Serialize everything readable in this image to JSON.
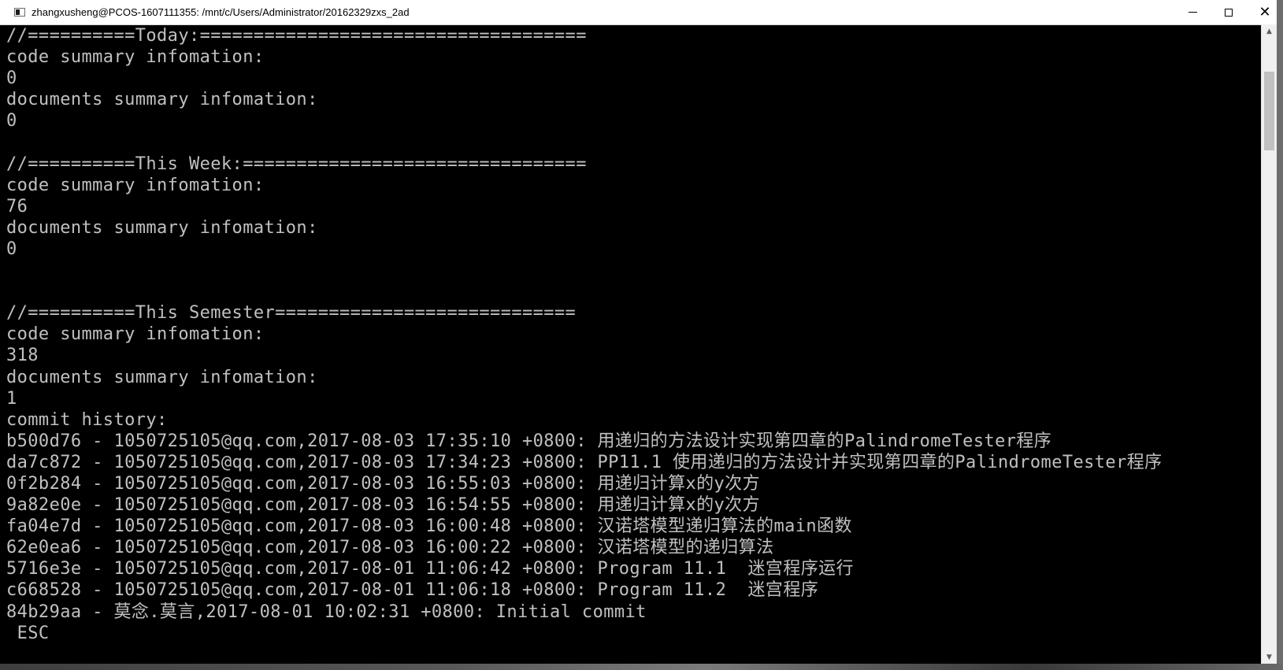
{
  "window": {
    "title": "zhangxusheng@PCOS-1607111355: /mnt/c/Users/Administrator/20162329zxs_2ad",
    "controls": {
      "minimize": "minimize-icon",
      "maximize": "maximize-icon",
      "close": "✕"
    }
  },
  "console": {
    "lines": [
      "//==========Today:====================================",
      "code summary infomation:",
      "0",
      "documents summary infomation:",
      "0",
      "",
      "//==========This Week:================================",
      "code summary infomation:",
      "76",
      "documents summary infomation:",
      "0",
      "",
      "",
      "//==========This Semester============================",
      "code summary infomation:",
      "318",
      "documents summary infomation:",
      "1",
      "commit history:",
      "b500d76 - 1050725105@qq.com,2017-08-03 17:35:10 +0800: 用递归的方法设计实现第四章的PalindromeTester程序",
      "da7c872 - 1050725105@qq.com,2017-08-03 17:34:23 +0800: PP11.1 使用递归的方法设计并实现第四章的PalindromeTester程序",
      "0f2b284 - 1050725105@qq.com,2017-08-03 16:55:03 +0800: 用递归计算x的y次方",
      "9a82e0e - 1050725105@qq.com,2017-08-03 16:54:55 +0800: 用递归计算x的y次方",
      "fa04e7d - 1050725105@qq.com,2017-08-03 16:00:48 +0800: 汉诺塔模型递归算法的main函数",
      "62e0ea6 - 1050725105@qq.com,2017-08-03 16:00:22 +0800: 汉诺塔模型的递归算法",
      "5716e3e - 1050725105@qq.com,2017-08-01 11:06:42 +0800: Program 11.1  迷宫程序运行",
      "c668528 - 1050725105@qq.com,2017-08-01 11:06:18 +0800: Program 11.2  迷宫程序",
      "84b29aa - 莫念.莫言,2017-08-01 10:02:31 +0800: Initial commit",
      " ESC"
    ]
  },
  "colors": {
    "console_bg": "#000000",
    "console_fg": "#c0c0c0",
    "titlebar_bg": "#ffffff"
  }
}
